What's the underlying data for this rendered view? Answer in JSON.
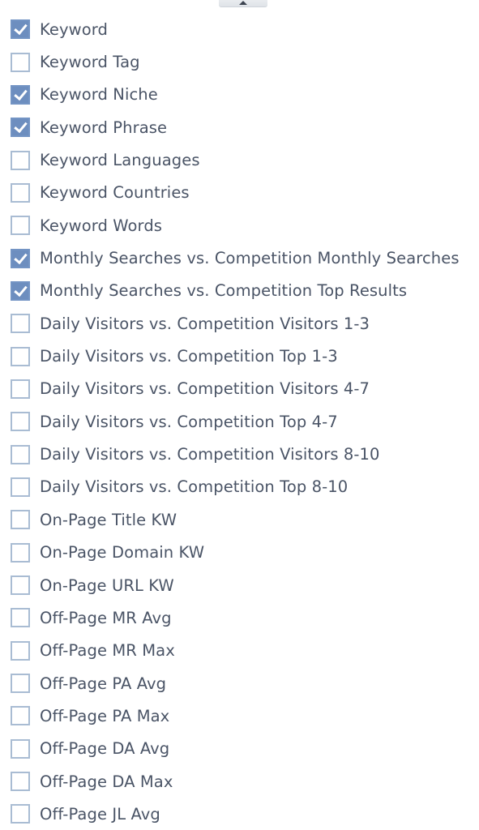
{
  "collapse_handle": {
    "icon": "caret-up-icon"
  },
  "columns": [
    {
      "label": "Keyword",
      "checked": true
    },
    {
      "label": "Keyword Tag",
      "checked": false
    },
    {
      "label": "Keyword Niche",
      "checked": true
    },
    {
      "label": "Keyword Phrase",
      "checked": true
    },
    {
      "label": "Keyword Languages",
      "checked": false
    },
    {
      "label": "Keyword Countries",
      "checked": false
    },
    {
      "label": "Keyword Words",
      "checked": false
    },
    {
      "label": "Monthly Searches vs. Competition Monthly Searches",
      "checked": true
    },
    {
      "label": "Monthly Searches vs. Competition Top Results",
      "checked": true
    },
    {
      "label": "Daily Visitors vs. Competition Visitors 1-3",
      "checked": false
    },
    {
      "label": "Daily Visitors vs. Competition Top 1-3",
      "checked": false
    },
    {
      "label": "Daily Visitors vs. Competition Visitors 4-7",
      "checked": false
    },
    {
      "label": "Daily Visitors vs. Competition Top 4-7",
      "checked": false
    },
    {
      "label": "Daily Visitors vs. Competition Visitors 8-10",
      "checked": false
    },
    {
      "label": "Daily Visitors vs. Competition Top 8-10",
      "checked": false
    },
    {
      "label": "On-Page Title KW",
      "checked": false
    },
    {
      "label": "On-Page Domain KW",
      "checked": false
    },
    {
      "label": "On-Page URL KW",
      "checked": false
    },
    {
      "label": "Off-Page MR Avg",
      "checked": false
    },
    {
      "label": "Off-Page MR Max",
      "checked": false
    },
    {
      "label": "Off-Page PA Avg",
      "checked": false
    },
    {
      "label": "Off-Page PA Max",
      "checked": false
    },
    {
      "label": "Off-Page DA Avg",
      "checked": false
    },
    {
      "label": "Off-Page DA Max",
      "checked": false
    },
    {
      "label": "Off-Page JL Avg",
      "checked": false
    }
  ],
  "colors": {
    "checked_fill": "#6d8ebf",
    "unchecked_border": "#a9bcd3",
    "label_text": "#4a5466"
  }
}
